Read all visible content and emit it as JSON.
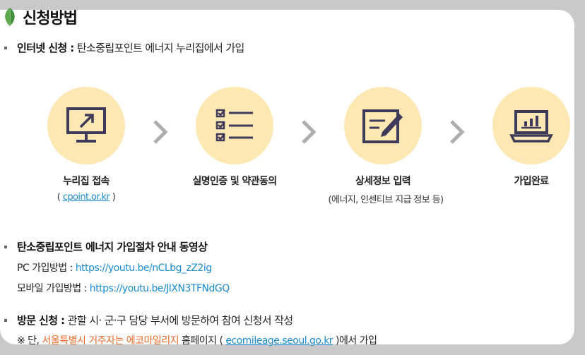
{
  "title": "신청방법",
  "internet": {
    "label": "인터넷 신청 :",
    "text": "탄소중립포인트 에너지 누리집에서 가입"
  },
  "steps": [
    {
      "label": "누리집 접속",
      "note_open": "( ",
      "note_link": "cpoint.or.kr",
      "note_close": " )",
      "icon": "monitor-arrow-icon"
    },
    {
      "label": "실명인증 및 약관동의",
      "icon": "checklist-icon"
    },
    {
      "label": "상세정보 입력",
      "note": "(에너지, 인센티브 지급 정보 등)",
      "icon": "form-edit-icon"
    },
    {
      "label": "가입완료",
      "icon": "laptop-chart-icon"
    }
  ],
  "video": {
    "title": "탄소중립포인트 에너지 가입절차 안내 동영상",
    "pc_label": "PC 가입방법 :",
    "pc_url": "https://youtu.be/nCLbg_zZ2ig",
    "mobile_label": "모바일 가입방법 :",
    "mobile_url": "https://youtu.be/JIXN3TFNdGQ"
  },
  "visit": {
    "label": "방문 신청 :",
    "text": "관할 시· 군·구 담당 부서에 방문하여 참여 신청서 작성",
    "note_prefix": "※ 단, ",
    "note_highlight": "서울특별시 거주자는 에코마일리지",
    "note_mid": " 홈페이지 ( ",
    "note_link": "ecomileage.seoul.go.kr",
    "note_suffix": " )에서 가입"
  },
  "colors": {
    "circle": "#fde8b4",
    "icon": "#3d3a5a",
    "link": "#1a8bd0",
    "highlight": "#e86a2a",
    "leaf": "#3f8f3a"
  }
}
